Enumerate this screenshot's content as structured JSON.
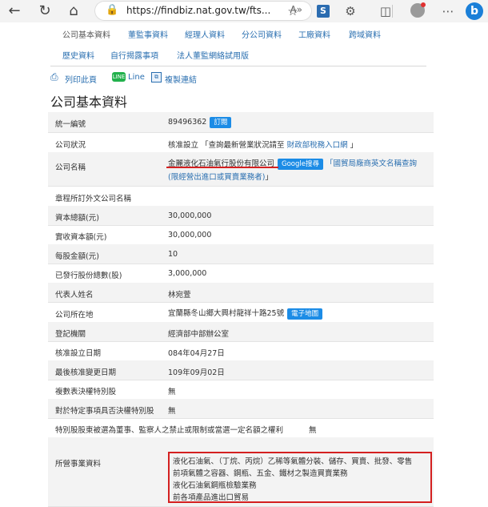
{
  "browser": {
    "url": "https://findbiz.nat.gov.tw/fts...",
    "read_aloud": "A»"
  },
  "tabs": [
    "公司基本資料",
    "董監事資料",
    "經理人資料",
    "分公司資料",
    "工廠資料",
    "跨域資料",
    "歷史資料",
    "自行揭露事項",
    "法人董監網絡試用版"
  ],
  "actions": {
    "print": "列印此頁",
    "line": "Line",
    "copy_link": "複製連結"
  },
  "page_title": "公司基本資料",
  "rows": {
    "tax_id": {
      "label": "統一編號",
      "value": "89496362",
      "badge": "訂閱"
    },
    "status": {
      "label": "公司狀況",
      "value_prefix": "核准設立 「查詢最新營業狀況請至",
      "value_link": "財政部稅務入口網",
      "value_suffix": "」"
    },
    "name": {
      "label": "公司名稱",
      "value": "金麗液化石油氣行股份有限公司",
      "google": "Google搜尋",
      "trade_link_1": "「國貿局廠商英文名稱查詢",
      "trade_link_2": "(限經營出進口或買賣業務者)",
      "trade_suffix": "」"
    },
    "foreign_name": {
      "label": "章程所訂外文公司名稱",
      "value": ""
    },
    "capital": {
      "label": "資本總額(元)",
      "value": "30,000,000"
    },
    "paid_capital": {
      "label": "實收資本額(元)",
      "value": "30,000,000"
    },
    "par_value": {
      "label": "每股金額(元)",
      "value": "10"
    },
    "shares": {
      "label": "已發行股份總數(股)",
      "value": "3,000,000"
    },
    "representative": {
      "label": "代表人姓名",
      "value": "林宛萱"
    },
    "address": {
      "label": "公司所在地",
      "value": "宜蘭縣冬山鄉大興村龍祥十路25號",
      "badge": "電子地圖"
    },
    "authority": {
      "label": "登記機關",
      "value": "經濟部中部辦公室"
    },
    "approved_date": {
      "label": "核准設立日期",
      "value": "084年04月27日"
    },
    "last_change": {
      "label": "最後核准變更日期",
      "value": "109年09月02日"
    },
    "multi_vote": {
      "label": "複數表決權特別股",
      "value": "無"
    },
    "veto": {
      "label": "對於特定事項具否決權特別股",
      "value": "無"
    },
    "director_limit": {
      "label": "特別股股東被選為董事、監察人之禁止或限制或當選一定名額之權利",
      "value": "無"
    },
    "business": {
      "label": "所營事業資料",
      "items": [
        "液化石油氣、（丁烷、丙烷）乙稀等氣體分裝、儲存、買賣、批發、零售",
        "前項氣體之容器、鋼瓶、五金、鐵材之製造買賣業務",
        "液化石油氣鋼瓶檢驗業務",
        "前各項產品進出口貿易"
      ]
    }
  },
  "colors": {
    "link": "#2a6fb0",
    "badge": "#1c8ce6",
    "highlight": "#d42020"
  }
}
